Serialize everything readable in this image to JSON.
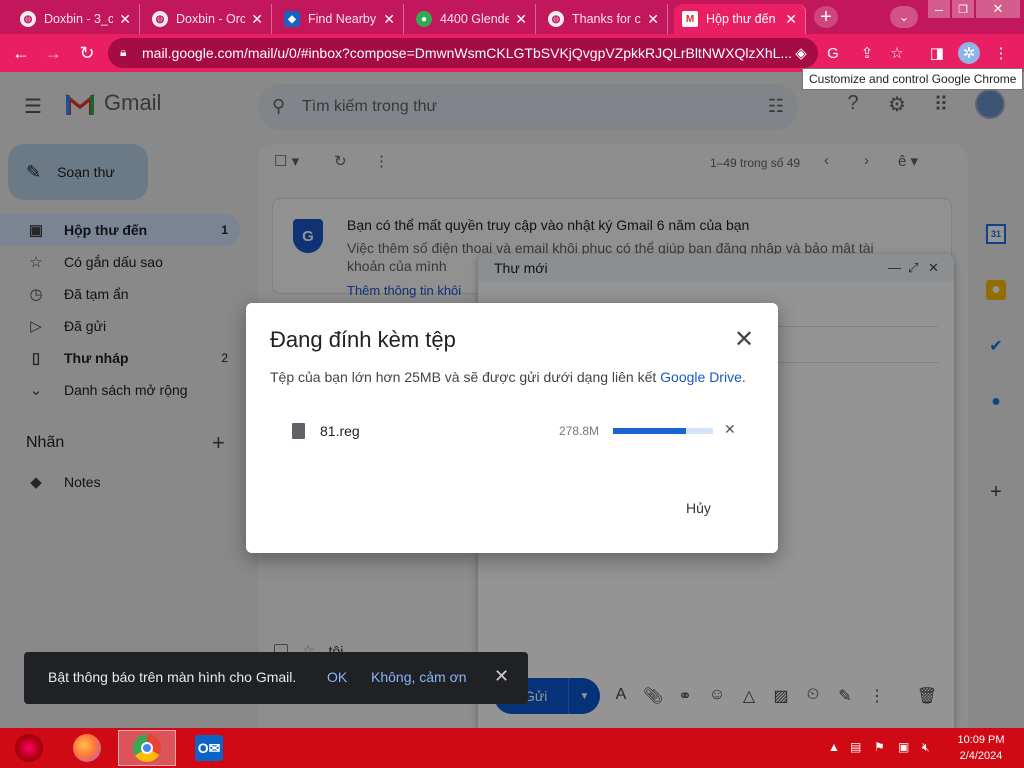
{
  "browser": {
    "tabs": [
      {
        "title": "Doxbin - 3_c",
        "icon": "globe-icon"
      },
      {
        "title": "Doxbin - Orc",
        "icon": "globe-icon"
      },
      {
        "title": "Find Nearby",
        "icon": "dominos-icon"
      },
      {
        "title": "4400 Glende",
        "icon": "maps-icon"
      },
      {
        "title": "Thanks for c",
        "icon": "globe-icon"
      },
      {
        "title": "Hộp thư đến",
        "icon": "gmail-icon",
        "active": true
      }
    ],
    "url": "mail.google.com/mail/u/0/#inbox?compose=DmwnWsmCKLGTbSVKjQvgpVZpkkRJQLrBltNWXQlzXhL...",
    "tooltip": "Customize and control Google Chrome",
    "accent_color": "#e91e63"
  },
  "gmail": {
    "brand": "Gmail",
    "search_placeholder": "Tìm kiếm trong thư",
    "compose_label": "Soạn thư",
    "sidebar": [
      {
        "label": "Hộp thư đến",
        "count": "1",
        "icon": "inbox-icon",
        "selected": true
      },
      {
        "label": "Có gắn dấu sao",
        "count": "",
        "icon": "star-icon"
      },
      {
        "label": "Đã tạm ẩn",
        "count": "",
        "icon": "clock-icon"
      },
      {
        "label": "Đã gửi",
        "count": "",
        "icon": "send-icon"
      },
      {
        "label": "Thư nháp",
        "count": "2",
        "icon": "draft-icon"
      },
      {
        "label": "Danh sách mở rộng",
        "count": "",
        "icon": "chevron-down-icon"
      }
    ],
    "labels_heading": "Nhãn",
    "labels": [
      {
        "label": "Notes",
        "icon": "label-icon"
      }
    ],
    "pager": "1–49 trong số 49",
    "banner": {
      "title": "Bạn có thể mất quyền truy cập vào nhật ký Gmail 6 năm của bạn",
      "body": "Việc thêm số điện thoại và email khôi phục có thể giúp bạn đăng nhập và bảo mật tài khoản của mình",
      "link": "Thêm thông tin khôi"
    },
    "row": {
      "subject": "tôi"
    },
    "compose_window": {
      "title": "Thư mới",
      "send_label": "Gửi"
    }
  },
  "dialog": {
    "title": "Đang đính kèm tệp",
    "message": "Tệp của bạn lớn hơn 25MB và sẽ được gửi dưới dạng liên kết",
    "link": "Google Drive",
    "message_end": ".",
    "file_name": "81.reg",
    "file_size": "278.8M",
    "progress": 0.73,
    "cancel_label": "Hủy"
  },
  "toast": {
    "message": "Bật thông báo trên màn hình cho Gmail.",
    "ok": "OK",
    "no": "Không, cảm ơn"
  },
  "taskbar": {
    "time": "10:09 PM",
    "date": "2/4/2024"
  }
}
